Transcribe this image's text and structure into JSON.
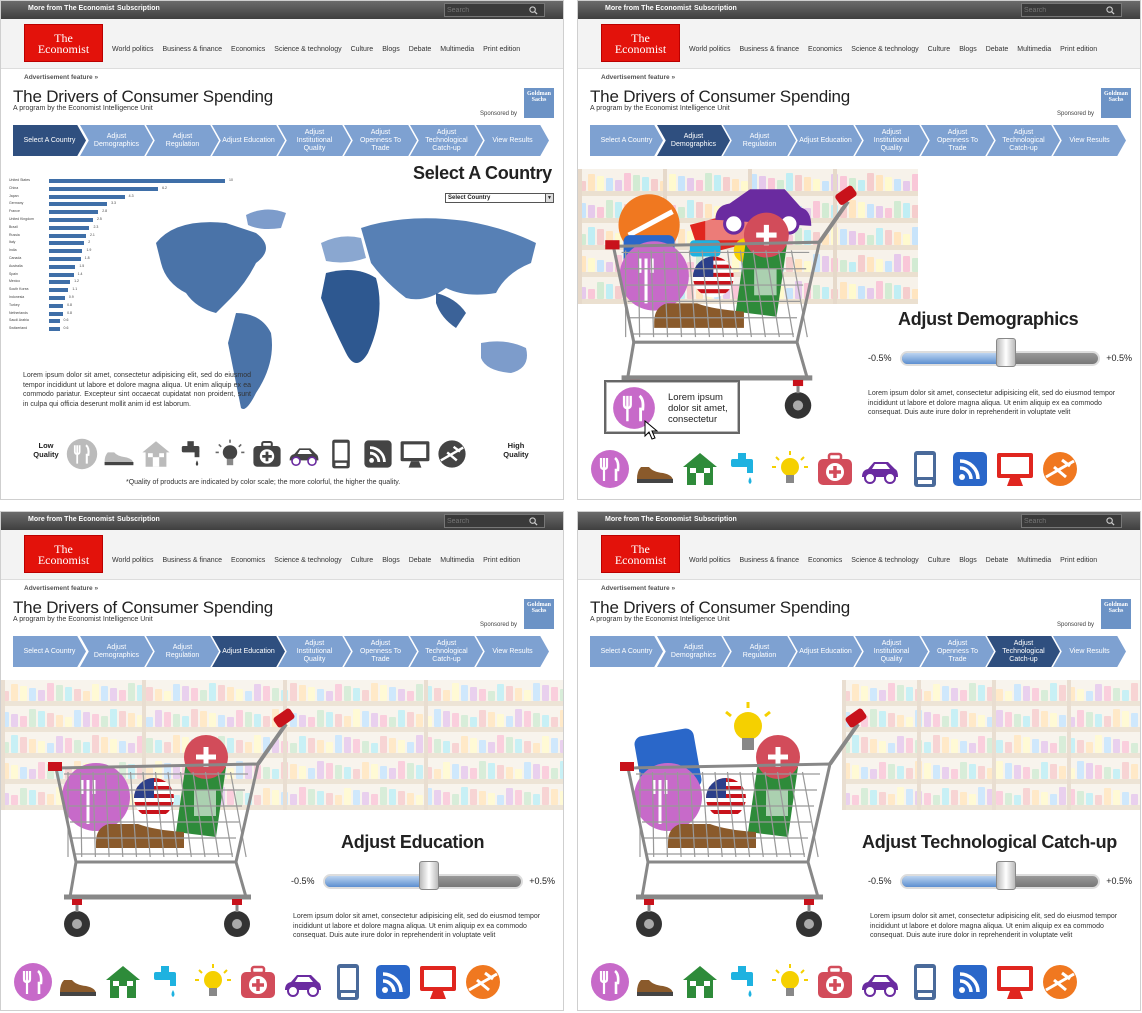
{
  "header": {
    "more_from": "More from The Economist",
    "subscription": "Subscription",
    "search_placeholder": "Search",
    "logo_line1": "The",
    "logo_line2": "Economist",
    "nav": [
      "World politics",
      "Business & finance",
      "Economics",
      "Science & technology",
      "Culture",
      "Blogs",
      "Debate",
      "Multimedia",
      "Print edition"
    ]
  },
  "feature": {
    "advert": "Advertisement feature »",
    "title": "The Drivers of Consumer Spending",
    "subtitle": "A program by the Economist Intelligence Unit",
    "sponsored": "Sponsored by",
    "sponsor_line1": "Goldman",
    "sponsor_line2": "Sachs"
  },
  "steps": [
    "Select A Country",
    "Adjust Demographics",
    "Adjust Regulation",
    "Adjust Education",
    "Adjust Institutional Quality",
    "Adjust Openness To Trade",
    "Adjust Technological Catch-up",
    "View Results"
  ],
  "panels": [
    {
      "active_step": 0,
      "heading": "Select A Country"
    },
    {
      "active_step": 1,
      "heading": "Adjust Demographics"
    },
    {
      "active_step": 3,
      "heading": "Adjust Education"
    },
    {
      "active_step": 6,
      "heading": "Adjust Technological Catch-up"
    }
  ],
  "select_country": {
    "dropdown_value": "Select Country",
    "body": "Lorem ipsum dolor sit amet, consectetur adipisicing elit, sed do eiusmod tempor incididunt ut labore et dolore magna aliqua. Ut enim aliquip ex ea commodo pariatur. Excepteur sint occaecat cupidatat non proident, sunt in culpa qui officia deserunt mollit anim id est laborum.",
    "low_quality": "Low Quality",
    "high_quality": "High Quality",
    "quality_note": "*Quality of products are indicated by color scale; the more colorful, the higher the quality."
  },
  "slider": {
    "min_label": "-0.5%",
    "max_label": "+0.5%",
    "value_fraction": 0.53,
    "body": "Lorem ipsum dolor sit amet, consectetur adipisicing elit, sed do eiusmod tempor incididunt ut labore et dolore magna aliqua. Ut enim aliquip ex ea commodo consequat. Duis aute irure dolor in reprehenderit in voluptate velit"
  },
  "tooltip": {
    "text": "Lorem ipsum dolor sit amet, consectetur"
  },
  "chart_data": {
    "type": "bar",
    "categories": [
      "United States",
      "China",
      "Japan",
      "Germany",
      "France",
      "United Kingdom",
      "Brazil",
      "Russia",
      "Italy",
      "India",
      "Canada",
      "Australia",
      "Spain",
      "Mexico",
      "South Korea",
      "Indonesia",
      "Turkey",
      "Netherlands",
      "Saudi Arabia",
      "Switzerland"
    ],
    "values": [
      10,
      6.2,
      4.3,
      3.3,
      2.8,
      2.5,
      2.3,
      2.1,
      2.0,
      1.9,
      1.8,
      1.5,
      1.4,
      1.2,
      1.1,
      0.9,
      0.8,
      0.8,
      0.6,
      0.6
    ]
  },
  "icons": [
    "utensils-icon",
    "shoe-icon",
    "house-icon",
    "faucet-icon",
    "lightbulb-icon",
    "medkit-icon",
    "car-icon",
    "phone-icon",
    "rss-icon",
    "monitor-icon",
    "plane-icon"
  ],
  "colors": {
    "economist_red": "#e3120b",
    "step_blue": "#7ea1d1",
    "step_active": "#2f4f7f",
    "map_blue": "#3f6fa8"
  }
}
